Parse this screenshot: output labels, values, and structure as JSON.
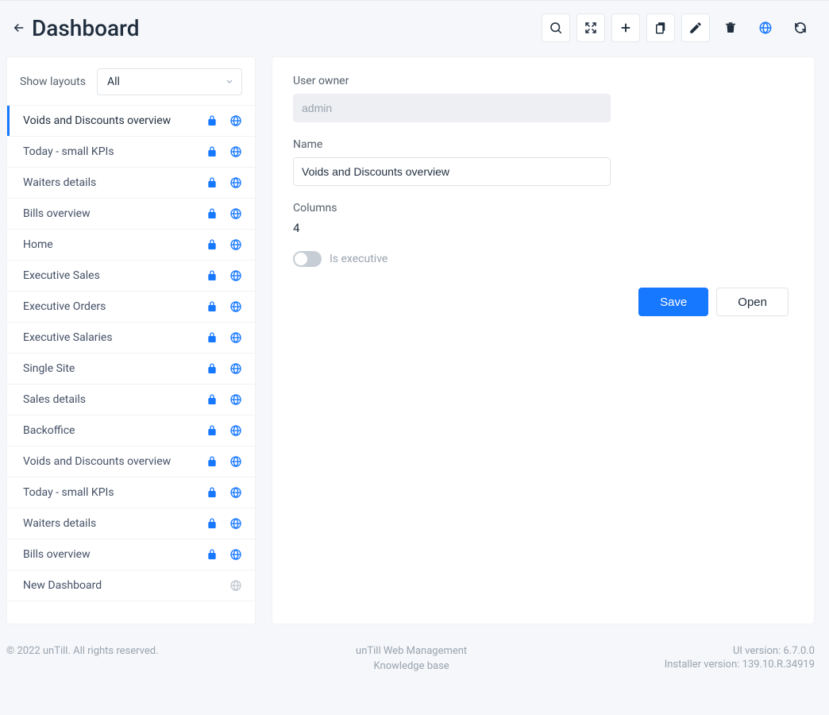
{
  "header": {
    "title": "Dashboard"
  },
  "toolbar": {
    "search": "search",
    "fullscreen": "fullscreen",
    "add": "add",
    "copy": "copy",
    "edit": "edit",
    "delete": "delete",
    "globe": "globe",
    "refresh": "refresh"
  },
  "sidebar": {
    "filter_label": "Show layouts",
    "filter_value": "All",
    "items": [
      {
        "name": "Voids and Discounts overview",
        "lock": true,
        "globe": true,
        "active": true
      },
      {
        "name": "Today - small KPIs",
        "lock": true,
        "globe": true
      },
      {
        "name": "Waiters details",
        "lock": true,
        "globe": true
      },
      {
        "name": "Bills overview",
        "lock": true,
        "globe": true
      },
      {
        "name": "Home",
        "lock": true,
        "globe": true
      },
      {
        "name": "Executive Sales",
        "lock": true,
        "globe": true
      },
      {
        "name": "Executive Orders",
        "lock": true,
        "globe": true
      },
      {
        "name": "Executive Salaries",
        "lock": true,
        "globe": true
      },
      {
        "name": "Single Site",
        "lock": true,
        "globe": true
      },
      {
        "name": "Sales details",
        "lock": true,
        "globe": true
      },
      {
        "name": "Backoffice",
        "lock": true,
        "globe": true
      },
      {
        "name": "Voids and Discounts overview",
        "lock": true,
        "globe": true
      },
      {
        "name": "Today - small KPIs",
        "lock": true,
        "globe": true
      },
      {
        "name": "Waiters details",
        "lock": true,
        "globe": true
      },
      {
        "name": "Bills overview",
        "lock": true,
        "globe": true
      },
      {
        "name": "New Dashboard",
        "lock": false,
        "globe": true,
        "globe_gray": true
      }
    ]
  },
  "form": {
    "user_owner_label": "User owner",
    "user_owner_value": "admin",
    "name_label": "Name",
    "name_value": "Voids and Discounts overview",
    "columns_label": "Columns",
    "columns_value": "4",
    "is_executive_label": "Is executive",
    "save_label": "Save",
    "open_label": "Open"
  },
  "footer": {
    "copyright": "© 2022 unTill. All rights reserved.",
    "center1": "unTill Web Management",
    "center2": "Knowledge base",
    "ui_version": "UI version: 6.7.0.0",
    "installer_version": "Installer version: 139.10.R.34919"
  }
}
